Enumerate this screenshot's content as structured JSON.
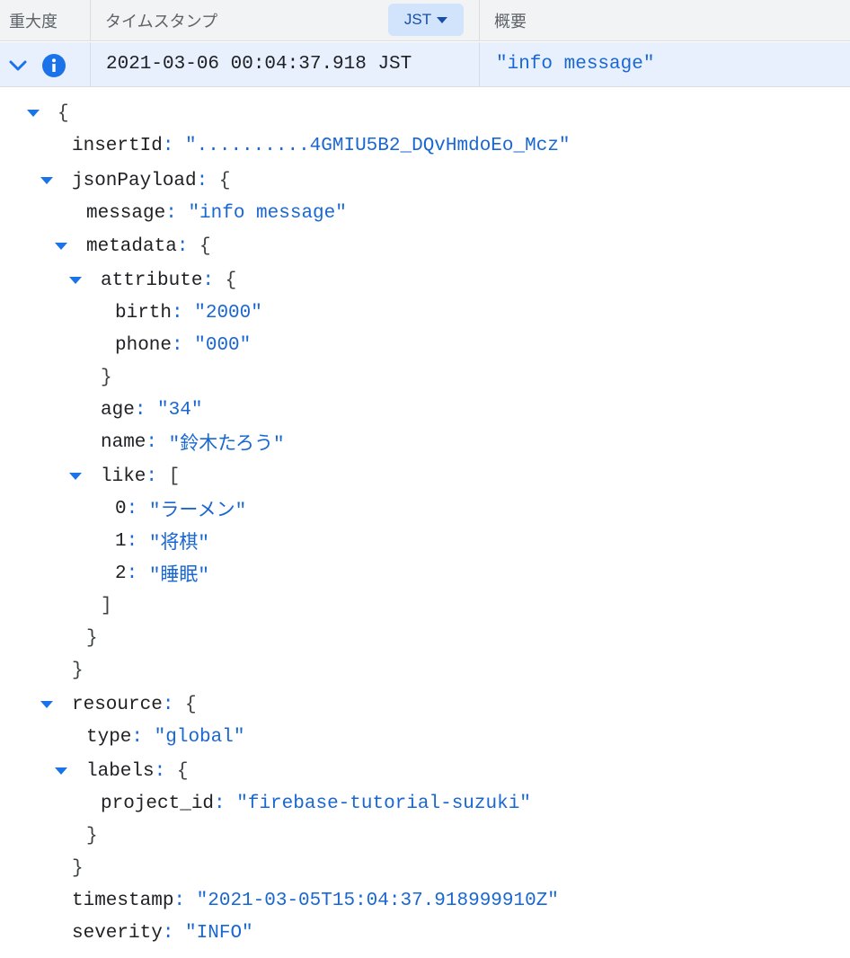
{
  "header": {
    "severity_label": "重大度",
    "timestamp_label": "タイムスタンプ",
    "timezone_button": "JST",
    "summary_label": "概要"
  },
  "entry": {
    "timestamp": "2021-03-06 00:04:37.918 JST",
    "summary": "\"info message\""
  },
  "tree": {
    "open_brace": "{",
    "insertId_key": "insertId",
    "insertId_val": "\"..........4GMIU5B2_DQvHmdoEo_Mcz\"",
    "jsonPayload_key": "jsonPayload",
    "message_key": "message",
    "message_val": "\"info message\"",
    "metadata_key": "metadata",
    "attribute_key": "attribute",
    "birth_key": "birth",
    "birth_val": "\"2000\"",
    "phone_key": "phone",
    "phone_val": "\"000\"",
    "age_key": "age",
    "age_val": "\"34\"",
    "name_key": "name",
    "name_val": "\"鈴木たろう\"",
    "like_key": "like",
    "like_0_key": "0",
    "like_0_val": "\"ラーメン\"",
    "like_1_key": "1",
    "like_1_val": "\"将棋\"",
    "like_2_key": "2",
    "like_2_val": "\"睡眠\"",
    "resource_key": "resource",
    "type_key": "type",
    "type_val": "\"global\"",
    "labels_key": "labels",
    "project_id_key": "project_id",
    "project_id_val": "\"firebase-tutorial-suzuki\"",
    "timestamp_key": "timestamp",
    "timestamp_val": "\"2021-03-05T15:04:37.918999910Z\"",
    "severity_key": "severity",
    "severity_val": "\"INFO\"",
    "obj_open": "{",
    "obj_close": "}",
    "arr_open": "[",
    "arr_close": "]",
    "colon": ":"
  },
  "colors": {
    "header_bg": "#f1f3f4",
    "row_bg": "#e8f0fe",
    "accent": "#1a73e8",
    "string": "#1967d2"
  },
  "icons": [
    "chevron-down-icon",
    "info-icon",
    "caret-down-icon"
  ]
}
